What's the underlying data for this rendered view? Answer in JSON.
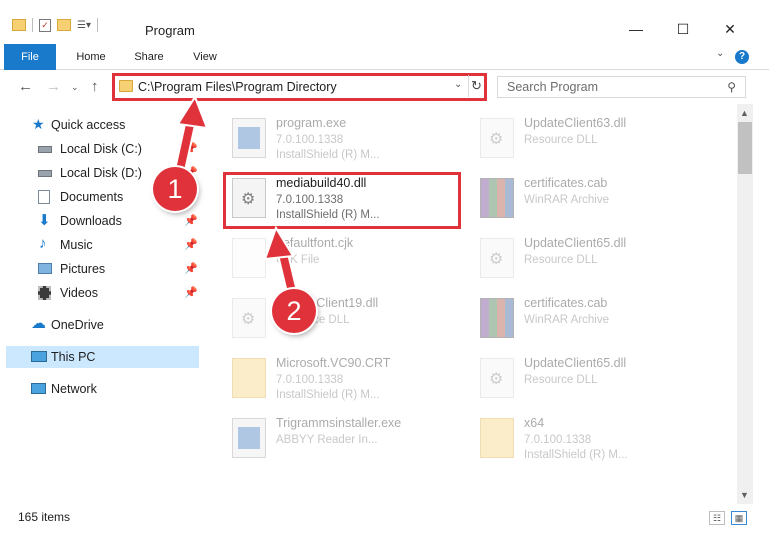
{
  "window": {
    "title": "Program",
    "controls": {
      "minimize": "—",
      "maximize": "☐",
      "close": "✕"
    }
  },
  "ribbon": {
    "tabs": [
      {
        "label": "File"
      },
      {
        "label": "Home"
      },
      {
        "label": "Share"
      },
      {
        "label": "View"
      }
    ],
    "help": "?"
  },
  "address": {
    "path": "C:\\Program Files\\Program Directory",
    "search_placeholder": "Search Program"
  },
  "sidebar": {
    "items": [
      {
        "label": "Quick access"
      },
      {
        "label": "Local Disk (C:)"
      },
      {
        "label": "Local Disk (D:)"
      },
      {
        "label": "Documents"
      },
      {
        "label": "Downloads"
      },
      {
        "label": "Music"
      },
      {
        "label": "Pictures"
      },
      {
        "label": "Videos"
      },
      {
        "label": "OneDrive"
      },
      {
        "label": "This PC"
      },
      {
        "label": "Network"
      }
    ]
  },
  "files": {
    "left": [
      {
        "name": "program.exe",
        "line1": "7.0.100.1338",
        "line2": "InstallShield (R) M..."
      },
      {
        "name": "mediabuild40.dll",
        "line1": "7.0.100.1338",
        "line2": "InstallShield (R) M..."
      },
      {
        "name": "defaultfont.cjk",
        "line1": "CJK File",
        "line2": ""
      },
      {
        "name": "UpdateClient19.dll",
        "line1": "Resource DLL",
        "line2": ""
      },
      {
        "name": "Microsoft.VC90.CRT",
        "line1": "7.0.100.1338",
        "line2": "InstallShield (R) M..."
      },
      {
        "name": "Trigrammsinstaller.exe",
        "line1": "ABBYY Reader In...",
        "line2": ""
      }
    ],
    "right": [
      {
        "name": "UpdateClient63.dll",
        "line1": "Resource DLL",
        "line2": ""
      },
      {
        "name": "certificates.cab",
        "line1": "WinRAR Archive",
        "line2": ""
      },
      {
        "name": "UpdateClient65.dll",
        "line1": "Resource DLL",
        "line2": ""
      },
      {
        "name": "certificates.cab",
        "line1": "WinRAR Archive",
        "line2": ""
      },
      {
        "name": "UpdateClient65.dll",
        "line1": "Resource DLL",
        "line2": ""
      },
      {
        "name": "x64",
        "line1": "7.0.100.1338",
        "line2": "InstallShield (R) M..."
      }
    ]
  },
  "status": {
    "item_count": "165 items"
  },
  "annotations": {
    "step1": "1",
    "step2": "2"
  },
  "colors": {
    "accent": "#1979ca",
    "highlight": "#e0323a",
    "selected": "#cce8ff"
  }
}
